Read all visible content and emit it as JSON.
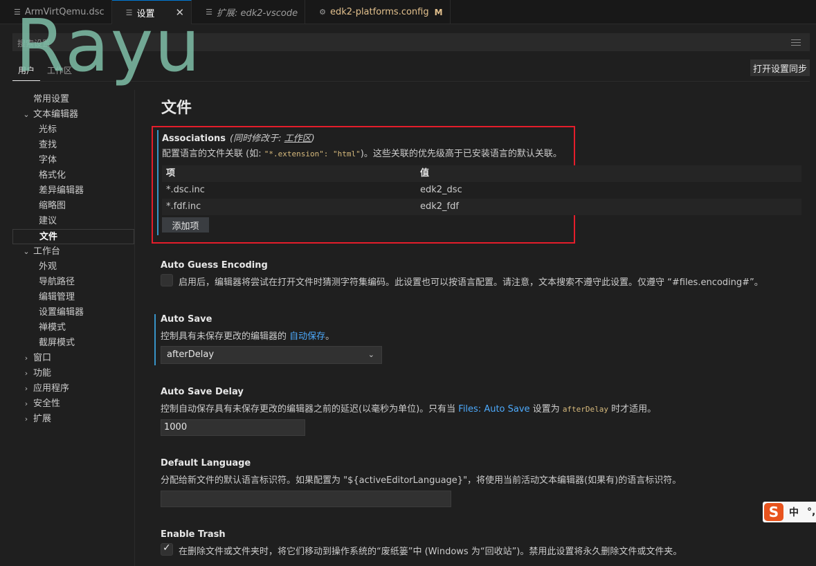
{
  "tabs": [
    {
      "label": "ArmVirtQemu.dsc",
      "icon": "lines-icon"
    },
    {
      "label": "设置",
      "icon": "lines-icon",
      "close": "✕"
    },
    {
      "label": "扩展: edk2-vscode",
      "icon": "lines-icon"
    },
    {
      "label": "edk2-platforms.config",
      "icon": "gear-icon",
      "badge": "M"
    }
  ],
  "watermark": "Rayu",
  "search": {
    "placeholder": "搜索设置"
  },
  "scope": {
    "user": "用户",
    "workspace": "工作区",
    "sync_button": "打开设置同步"
  },
  "toc": [
    {
      "label": "常用设置",
      "level": 0,
      "chevron": ""
    },
    {
      "label": "文本编辑器",
      "level": 0,
      "chevron": "⌄"
    },
    {
      "label": "光标",
      "level": 1
    },
    {
      "label": "查找",
      "level": 1
    },
    {
      "label": "字体",
      "level": 1
    },
    {
      "label": "格式化",
      "level": 1
    },
    {
      "label": "差异编辑器",
      "level": 1
    },
    {
      "label": "缩略图",
      "level": 1
    },
    {
      "label": "建议",
      "level": 1
    },
    {
      "label": "文件",
      "level": 1,
      "active": true
    },
    {
      "label": "工作台",
      "level": 0,
      "chevron": "⌄"
    },
    {
      "label": "外观",
      "level": 1
    },
    {
      "label": "导航路径",
      "level": 1
    },
    {
      "label": "编辑管理",
      "level": 1
    },
    {
      "label": "设置编辑器",
      "level": 1
    },
    {
      "label": "禅模式",
      "level": 1
    },
    {
      "label": "截屏模式",
      "level": 1
    },
    {
      "label": "窗口",
      "level": 0,
      "chevron": "›"
    },
    {
      "label": "功能",
      "level": 0,
      "chevron": "›"
    },
    {
      "label": "应用程序",
      "level": 0,
      "chevron": "›"
    },
    {
      "label": "安全性",
      "level": 0,
      "chevron": "›"
    },
    {
      "label": "扩展",
      "level": 0,
      "chevron": "›"
    }
  ],
  "section_title": "文件",
  "associations": {
    "title": "Associations",
    "modified_prefix": "(同时修改于: ",
    "modified_link": "工作区",
    "modified_suffix": ")",
    "desc_before": "配置语言的文件关联 (如: ",
    "desc_code": "\"*.extension\": \"html\"",
    "desc_after": ")。这些关联的优先级高于已安装语言的默认关联。",
    "col_key": "项",
    "col_value": "值",
    "rows": [
      {
        "key": "*.dsc.inc",
        "value": "edk2_dsc"
      },
      {
        "key": "*.fdf.inc",
        "value": "edk2_fdf"
      }
    ],
    "add_button": "添加项"
  },
  "auto_guess": {
    "title": "Auto Guess Encoding",
    "desc": "启用后，编辑器将尝试在打开文件时猜测字符集编码。此设置也可以按语言配置。请注意，文本搜索不遵守此设置。仅遵守 “#files.encoding#”。",
    "checked": false
  },
  "auto_save": {
    "title": "Auto Save",
    "desc_before": "控制具有未保存更改的编辑器的 ",
    "desc_link": "自动保存",
    "desc_after": "。",
    "value": "afterDelay"
  },
  "auto_save_delay": {
    "title": "Auto Save Delay",
    "desc_before": "控制自动保存具有未保存更改的编辑器之前的延迟(以毫秒为单位)。只有当 ",
    "desc_link": "Files: Auto Save",
    "desc_mid": " 设置为 ",
    "desc_code": "afterDelay",
    "desc_after": " 时才适用。",
    "value": "1000"
  },
  "default_language": {
    "title": "Default Language",
    "desc": "分配给新文件的默认语言标识符。如果配置为 \"${activeEditorLanguage}\"，将使用当前活动文本编辑器(如果有)的语言标识符。",
    "value": ""
  },
  "enable_trash": {
    "title": "Enable Trash",
    "desc": "在删除文件或文件夹时，将它们移动到操作系统的“废纸篓”中 (Windows 为“回收站”)。禁用此设置将永久删除文件或文件夹。",
    "checked": true
  },
  "ime": {
    "logo": "S",
    "mode": "中",
    "punct": "°,"
  },
  "colors": {
    "accent": "#0078d4",
    "highlight_border": "#e51d2b",
    "link": "#4daafc",
    "modified": "#e2c08d"
  }
}
